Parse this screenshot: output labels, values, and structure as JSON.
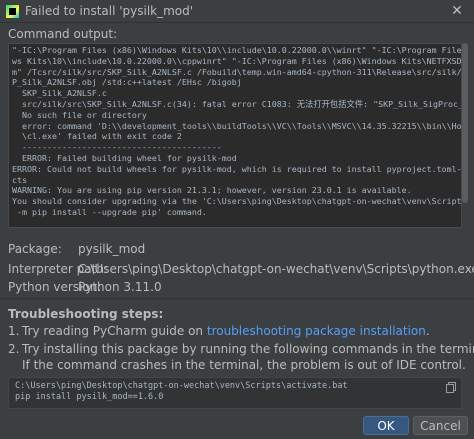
{
  "window": {
    "title": "Failed to install 'pysilk_mod'"
  },
  "command_output": {
    "label": "Command output:",
    "lines": [
      "\"-IC:\\Program Files (x86)\\Windows Kits\\10\\\\include\\10.0.22000.0\\\\winrt\" \"-IC:\\Program Files (x86)\\Windo",
      "ws Kits\\10\\\\include\\10.0.22000.0\\\\cppwinrt\" \"-IC:\\Program Files (x86)\\Windows Kits\\NETFXSDK\\4.8\\include\\u",
      "m\" /Tcsrc/silk/src/SKP_Silk_A2NLSF.c /Fobuild\\temp.win-amd64-cpython-311\\Release\\src/silk/src\\SK",
      "P_Silk_A2NLSF.obj /std:c++latest /EHsc /bigobj",
      "  SKP_Silk_A2NLSF.c",
      "  src/silk/src\\SKP_Silk_A2NLSF.c(34): fatal error C1083: 无法打开包括文件: \"SKP_Silk_SigProc_FIX.h\":",
      "  No such file or directory",
      "  error: command 'D:\\\\development_tools\\\\buildTools\\\\VC\\\\Tools\\\\MSVC\\\\14.35.32215\\\\bin\\\\HostX86\\\\x64\\",
      "  \\cl.exe' failed with exit code 2",
      "  ----------------------------------------",
      "  ERROR: Failed building wheel for pysilk-mod",
      "ERROR: Could not build wheels for pysilk-mod, which is required to install pyproject.toml-based proje",
      "cts",
      "WARNING: You are using pip version 21.3.1; however, version 23.0.1 is available.",
      "You should consider upgrading via the 'C:\\Users\\ping\\Desktop\\chatgpt-on-wechat\\venv\\Scripts\\python.exe",
      " -m pip install --upgrade pip' command."
    ]
  },
  "details": {
    "package_label": "Package:",
    "package_value": "pysilk_mod",
    "interpreter_label": "Interpreter path:",
    "interpreter_value": "C:\\Users\\ping\\Desktop\\chatgpt-on-wechat\\venv\\Scripts\\python.exe",
    "python_version_label": "Python version:",
    "python_version_value": "Python 3.11.0"
  },
  "troubleshooting": {
    "heading": "Troubleshooting steps:",
    "step1_num": "1.",
    "step1_prefix": "Try reading PyCharm guide on ",
    "step1_link": "troubleshooting package installation",
    "step1_suffix": ".",
    "step2_num": "2.",
    "step2_text": "Try installing this package by running the following commands in the terminal.",
    "step2_note": "If the command crashes in the terminal, the problem is out of IDE control.",
    "commands": "C:\\Users\\ping\\Desktop\\chatgpt-on-wechat\\venv\\Scripts\\activate.bat\npip install pysilk_mod==1.6.0"
  },
  "buttons": {
    "ok": "OK",
    "cancel": "Cancel"
  },
  "colors": {
    "background": "#3c3f41",
    "link": "#589df6",
    "ok_button": "#365880"
  },
  "icons": {
    "app": "pycharm-icon",
    "close": "close-icon",
    "copy": "copy-icon"
  }
}
